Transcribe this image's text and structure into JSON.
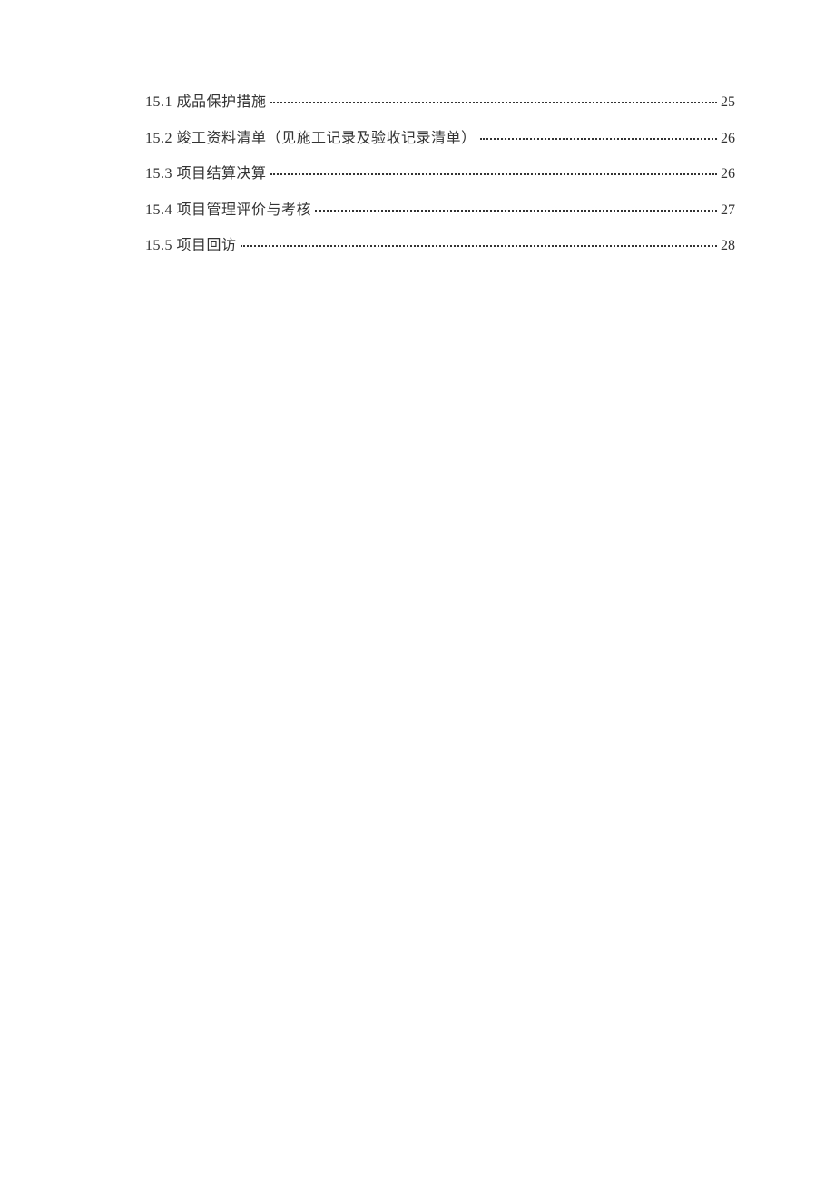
{
  "toc": {
    "entries": [
      {
        "label": "15.1 成品保护措施",
        "page": "25"
      },
      {
        "label": "15.2 竣工资料清单（见施工记录及验收记录清单）",
        "page": "26"
      },
      {
        "label": "15.3 项目结算决算",
        "page": "26"
      },
      {
        "label": "15.4 项目管理评价与考核",
        "page": "27"
      },
      {
        "label": "15.5 项目回访",
        "page": "28"
      }
    ]
  }
}
